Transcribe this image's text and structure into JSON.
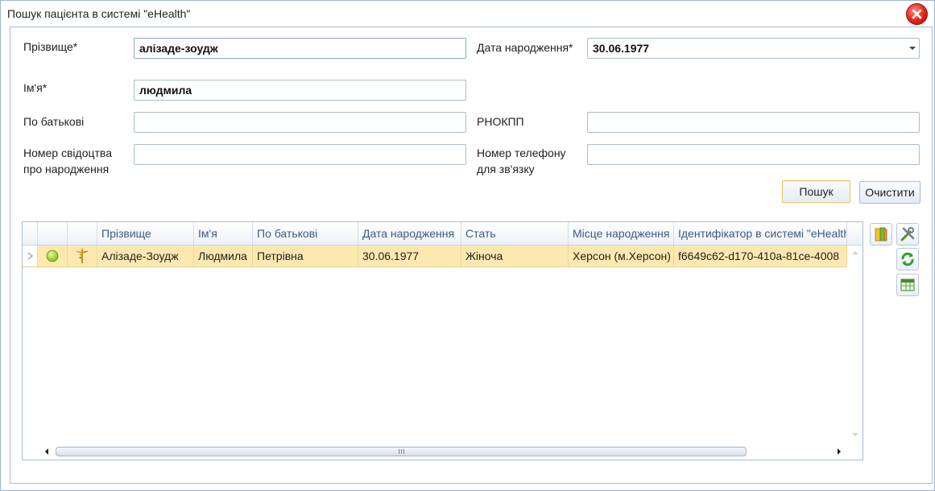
{
  "window": {
    "title": "Пошук пацієнта в системі \"eHealth\""
  },
  "form": {
    "surname": {
      "label": "Прізвище*",
      "value": "алізаде-зоудж"
    },
    "birth_date": {
      "label": "Дата народження*",
      "value": "30.06.1977"
    },
    "name": {
      "label": "Ім'я*",
      "value": "людмила"
    },
    "patronymic": {
      "label": "По батькові",
      "value": ""
    },
    "rnokpp": {
      "label": "РНОКПП",
      "value": ""
    },
    "birth_certificate": {
      "label": "Номер свідоцтва про народження",
      "value": ""
    },
    "phone": {
      "label": "Номер телефону для зв'язку",
      "value": ""
    },
    "search_button": "Пошук",
    "clear_button": "Очистити"
  },
  "grid": {
    "columns": [
      "Прізвище",
      "Ім'я",
      "По батькові",
      "Дата народження",
      "Стать",
      "Місце народження",
      "Ідентифікатор в системі \"eHealth\""
    ],
    "rows": [
      {
        "status": "active",
        "surname": "Алізаде-Зоудж",
        "name": "Людмила",
        "patronymic": "Петрівна",
        "birth_date": "30.06.1977",
        "sex": "Жіноча",
        "birth_place": "Херсон (м.Херсон)",
        "ehealth_id": "f6649c62-d170-410a-81ce-4008"
      }
    ]
  },
  "toolbar": {
    "icons": [
      "book-icon",
      "tools-icon",
      "refresh-icon",
      "table-export-icon"
    ]
  },
  "colors": {
    "selection": "#fde9b0",
    "border": "#a9bdd6",
    "header_text": "#3b5a82"
  }
}
